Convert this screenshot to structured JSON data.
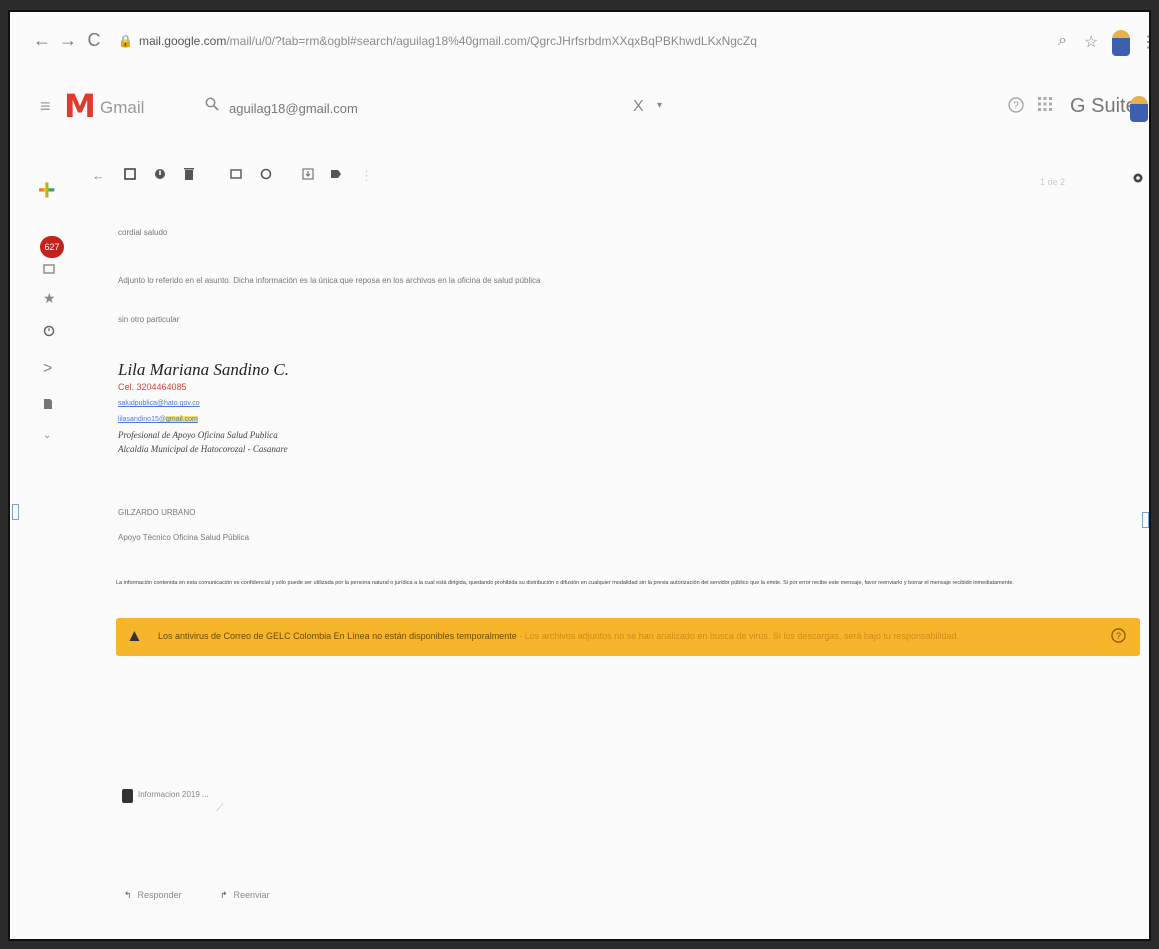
{
  "browser": {
    "back": "←",
    "forward": "→",
    "reload": "C",
    "lock": "🔒",
    "url_host": "mail.google.com",
    "url_path": "/mail/u/0/?tab=rm&ogbl#search/aguilag18%40gmail.com/QgrcJHrfsrbdmXXqxBqPBKhwdLKxNgcZq",
    "zoom_icon": "⌕",
    "star_icon": "☆",
    "menu_icon": "⋮"
  },
  "gmail": {
    "menu_icon": "≡",
    "logo_letter": "M",
    "app_name": "Gmail",
    "search_value": "aguilag18@gmail.com",
    "search_clear": "X",
    "search_options": "▾",
    "help_icon": "?",
    "apps_icon": "⋮⋮⋮",
    "gsuite_label": "G Suite"
  },
  "rail": {
    "compose": "+",
    "inbox_count": "627"
  },
  "toolbar": {
    "back": "←",
    "pager_text": "1 de 2"
  },
  "message": {
    "greeting": "cordial saludo",
    "body_line": "Adjunto lo referido en el asunto. Dicha información es la única que reposa en los archivos en la oficina de salud pública",
    "closing": "sin otro particular",
    "signature": {
      "name": "Lila  Mariana Sandino C.",
      "phone": "Cel. 3204464085",
      "email1": "saludpublica@hato.gov.co",
      "email2_prefix": "lilasandino15@",
      "email2_highlight": "gmail.com",
      "role": "Profesional de Apoyo Oficina Salud Publica",
      "org": "Alcaldía Municipal de Hatocorozal - Casanare"
    },
    "sender2_name": "GILZARDO URBANO",
    "sender2_role": "Apoyo Técnico  Oficina Salud Pública",
    "disclaimer": "La información contenida en esta comunicación es confidencial y sólo puede ser utilizada por la persona natural o jurídica a la cual está dirigida, quedando prohibida su distribución o difusión en cualquier modalidad sin la previa autorización del servidor público que la emite. Si por error recibe este mensaje, favor reenviarlo y borrar el mensaje recibido inmediatamente."
  },
  "warning": {
    "title": "Los antivirus de Correo de GELC Colombia En Línea no están disponibles temporalmente",
    "detail": " - Los archivos adjuntos no se han analizado en busca de virus. Si los descargas, será bajo tu responsabilidad.",
    "icon": "▲",
    "help": "?"
  },
  "attachment": {
    "name": "Informacion 2019 ..."
  },
  "actions": {
    "reply": "Responder",
    "forward": "Reenviar"
  },
  "colors": {
    "warning_bg": "#f7b52c",
    "gmail_red": "#e03a2f",
    "badge_red": "#c5221f"
  }
}
